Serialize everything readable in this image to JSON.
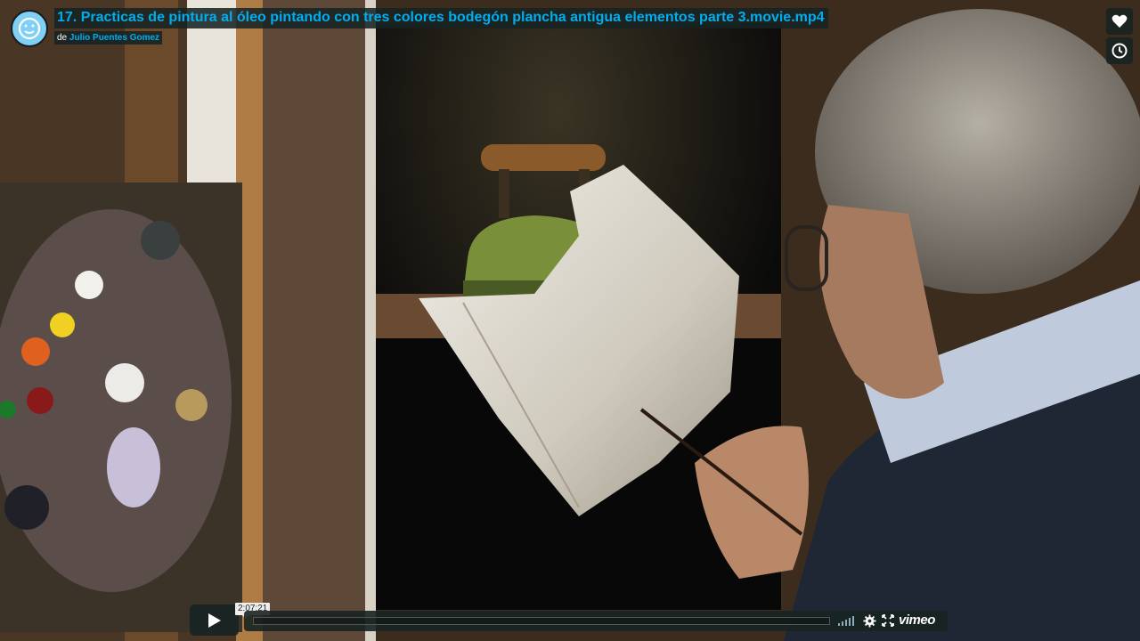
{
  "video": {
    "title": "17. Practicas de pintura al óleo pintando con tres colores bodegón plancha antigua elementos parte 3.movie.mp4",
    "byline_prefix": "de",
    "author": "Julio Puentes Gomez"
  },
  "player": {
    "time_display": "2:07:21",
    "progress": 0,
    "brand": "vimeo",
    "accent_color": "#00adef"
  },
  "icons": {
    "like": "heart-icon",
    "watch_later": "clock-icon",
    "play": "play-icon",
    "volume": "volume-icon",
    "settings": "gear-icon",
    "fullscreen": "fullscreen-icon"
  }
}
